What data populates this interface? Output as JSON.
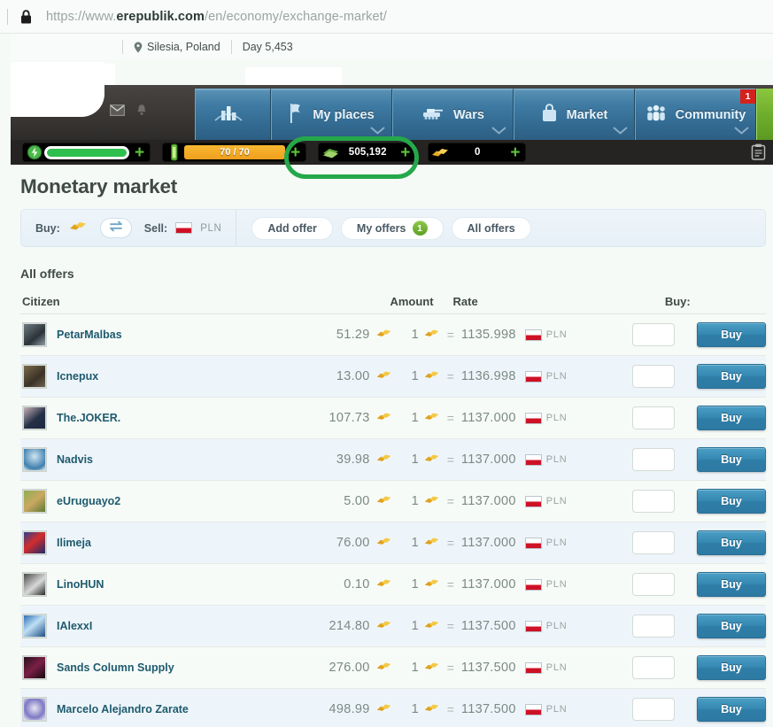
{
  "browser": {
    "url_scheme": "https://www.",
    "url_domain": "erepublik.com",
    "url_path": "/en/economy/exchange-market/",
    "lock_icon": "lock-icon"
  },
  "topbar": {
    "location": "Silesia, Poland",
    "day": "Day 5,453",
    "pin_icon": "map-pin-icon"
  },
  "nav": {
    "icons": [
      {
        "name": "envelope-icon"
      },
      {
        "name": "bell-icon"
      }
    ],
    "tabs": [
      {
        "label": "",
        "icon": "buildings-icon",
        "badge": "",
        "has_chevron": false
      },
      {
        "label": "My places",
        "icon": "flag-icon",
        "badge": "",
        "has_chevron": true
      },
      {
        "label": "Wars",
        "icon": "tank-icon",
        "badge": "",
        "has_chevron": true
      },
      {
        "label": "Market",
        "icon": "bag-icon",
        "badge": "",
        "has_chevron": true
      },
      {
        "label": "Community",
        "icon": "people-icon",
        "badge": "1",
        "has_chevron": true
      }
    ],
    "green_tab_icon": "money-stack-icon"
  },
  "stats": {
    "energy": {
      "icon": "energy-icon",
      "value": "",
      "redacted": true,
      "plus": "+"
    },
    "xp": {
      "icon": "xp-bottle-icon",
      "value": "70 / 70",
      "plus": "+"
    },
    "currency": {
      "icon": "money-stack-icon",
      "value": "505,192",
      "plus": "+",
      "highlighted": true
    },
    "gold": {
      "icon": "gold-bars-icon",
      "value": "0",
      "plus": "+"
    },
    "clipboard_icon": "clipboard-icon"
  },
  "highlight_color": "#25a84a",
  "page": {
    "title": "Monetary market",
    "section_title": "All offers"
  },
  "filterbar": {
    "buy_label": "Buy:",
    "buy_icon": "gold-bars-icon",
    "swap_icon": "swap-arrows-icon",
    "sell_label": "Sell:",
    "sell_flag": "flag-poland-icon",
    "sell_currency": "PLN",
    "buttons": [
      {
        "label": "Add offer",
        "count": ""
      },
      {
        "label": "My offers",
        "count": "1"
      },
      {
        "label": "All offers",
        "count": ""
      }
    ]
  },
  "table": {
    "headers": {
      "citizen": "Citizen",
      "amount": "Amount",
      "rate": "Rate",
      "buy": "Buy:"
    },
    "rate_prefix": "1",
    "rate_equals": "=",
    "rate_currency": "PLN",
    "gold_icon": "gold-bars-icon",
    "buy_button_label": "Buy",
    "qty_placeholder": "",
    "rows": [
      {
        "citizen": "PetarMalbas",
        "amount": "51.29",
        "rate": "1135.998",
        "qty": "",
        "avatar_bg": "linear-gradient(140deg,#6d7a82,#2b3338 60%,#8f9ea6)"
      },
      {
        "citizen": "Icnepux",
        "amount": "13.00",
        "rate": "1136.998",
        "qty": "",
        "avatar_bg": "linear-gradient(140deg,#7b6a4a,#3a3226 60%,#6f6350)"
      },
      {
        "citizen": "The.JOKER.",
        "amount": "107.73",
        "rate": "1137.000",
        "qty": "",
        "avatar_bg": "linear-gradient(140deg,#c7b3b8,#253047 55%,#1d2740)"
      },
      {
        "citizen": "Nadvis",
        "amount": "39.98",
        "rate": "1137.000",
        "qty": "",
        "avatar_bg": "radial-gradient(circle at 50% 35%,#cfe4f2,#3f7fae 70%,#e8f1f6)"
      },
      {
        "citizen": "eUruguayo2",
        "amount": "5.00",
        "rate": "1137.000",
        "qty": "",
        "avatar_bg": "linear-gradient(140deg,#8fae55,#caa861 50%,#5e7a33)"
      },
      {
        "citizen": "Ilimeja",
        "amount": "76.00",
        "rate": "1137.000",
        "qty": "",
        "avatar_bg": "linear-gradient(140deg,#2b3f8f,#d42c2c 45%,#1e2d6b)"
      },
      {
        "citizen": "LinoHUN",
        "amount": "0.10",
        "rate": "1137.000",
        "qty": "",
        "avatar_bg": "linear-gradient(140deg,#4c4c4c,#d8d8d8 55%,#2a2a2a)"
      },
      {
        "citizen": "IAlexxI",
        "amount": "214.80",
        "rate": "1137.500",
        "qty": "",
        "avatar_bg": "linear-gradient(140deg,#2f6fb5,#bfe0f5 45%,#1e4e86)"
      },
      {
        "citizen": "Sands Column Supply",
        "amount": "276.00",
        "rate": "1137.500",
        "qty": "",
        "avatar_bg": "linear-gradient(140deg,#2a1020,#7a2044 50%,#140810)"
      },
      {
        "citizen": "Marcelo Alejandro Zarate",
        "amount": "498.99",
        "rate": "1137.500",
        "qty": "",
        "avatar_bg": "radial-gradient(circle at 50% 45%,#e8e4f2,#7e79c4 60%,#f2eef8)"
      }
    ]
  }
}
